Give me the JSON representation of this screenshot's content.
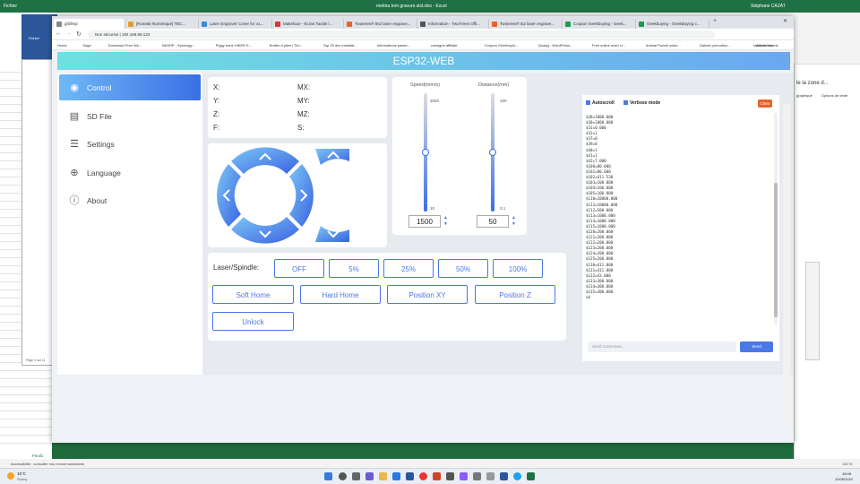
{
  "excel": {
    "title": "mektra tom gravure.xlsl.xlsx - Excel",
    "user": "Stéphane CAZAT",
    "sheet_tab": "Feuil1",
    "status_left": "Accessibilité : consulter nos recommandations",
    "right_panel_title": "le la zone d...",
    "right_panel_sub1": "graphique",
    "right_panel_sub2": "Options de texte",
    "zoom": "100 %"
  },
  "word": {
    "label": "Fichier",
    "page": "Page 1 sur 11"
  },
  "taskbar": {
    "weather_temp": "16°C",
    "weather_desc": "Sunny",
    "time": "18:08",
    "date": "12/06/2022"
  },
  "browser": {
    "tabs": [
      {
        "label": "grblhvp",
        "color": "#888"
      },
      {
        "label": "[Rosette Numérique] TBC...",
        "color": "#e39d2a"
      },
      {
        "label": "Laser Engraver Cover for v1...",
        "color": "#3a8ad6"
      },
      {
        "label": "Makeface - Écran Tactile l...",
        "color": "#d33"
      },
      {
        "label": "Twotrees® tts2 laser engrave...",
        "color": "#e8622c"
      },
      {
        "label": "Information - TwoTrees Offi...",
        "color": "#555"
      },
      {
        "label": "Twotrees® ts2 laser engrave...",
        "color": "#e8622c"
      },
      {
        "label": "Coupon Geekbuying - Geek...",
        "color": "#1c9b4d"
      },
      {
        "label": "Geekbuying - GeekBuying c...",
        "color": "#1c9b4d"
      }
    ],
    "url": "Non sécurisé | 192.168.68.122",
    "bookmarks": [
      "Home",
      "Sage",
      "Download Free We...",
      "NASHP - Synology...",
      "Piggy bank HIKER E...",
      "Boîtier à piles | Tim...",
      "Top 25 des installat...",
      "Informations passe...",
      "consigne affiliate",
      "Coupon Geekbuyin...",
      "Quaag - WordPress...",
      "Free online word cl...",
      "Animal Puzzle swim...",
      "Gabaix promotion...",
      "shellcatches",
      "Autres favoris"
    ]
  },
  "app": {
    "title": "ESP32-WEB",
    "nav": [
      {
        "label": "Control",
        "icon": "gamepad-icon"
      },
      {
        "label": "SD File",
        "icon": "file-icon"
      },
      {
        "label": "Settings",
        "icon": "settings-icon"
      },
      {
        "label": "Language",
        "icon": "globe-icon"
      },
      {
        "label": "About",
        "icon": "info-icon"
      }
    ],
    "coords": {
      "x": "X:",
      "y": "Y:",
      "z": "Z:",
      "f": "F:",
      "mx": "MX:",
      "my": "MY:",
      "mz": "MZ:",
      "s": "S:"
    },
    "speed": {
      "label": "Speed(mm/s)",
      "max": "3000",
      "min": "10",
      "value": "1500",
      "level": 0.5
    },
    "distance": {
      "label": "Distance(mm)",
      "max": "100",
      "min": "0.1",
      "value": "50",
      "level": 0.5
    },
    "laser": {
      "label": "Laser/Spindle:",
      "buttons": [
        "OFF",
        "5%",
        "25%",
        "50%",
        "100%"
      ]
    },
    "actions": [
      "Soft Home",
      "Hard Home",
      "Position XY",
      "Position Z"
    ],
    "unlock": "Unlock",
    "console": {
      "autoscroll": "Autoscroll",
      "verbose": "Verbose mode",
      "clear": "Clear",
      "lines": [
        "$28=1000.000",
        "$30=1000.000",
        "$31=0.000",
        "$32=1",
        "$37=0",
        "$39=0",
        "$40=1",
        "$41=1",
        "$42=7.000",
        "$100=80.000",
        "$101=80.000",
        "$102=411.530",
        "$103=100.000",
        "$104=100.000",
        "$105=100.000",
        "$110=10000.000",
        "$111=10000.000",
        "$112=500.000",
        "$113=1000.000",
        "$114=1000.000",
        "$115=1000.000",
        "$120=200.000",
        "$121=200.000",
        "$122=200.000",
        "$123=200.000",
        "$124=200.000",
        "$125=200.000",
        "$130=411.000",
        "$131=411.000",
        "$132=43.000",
        "$133=300.000",
        "$134=300.000",
        "$135=300.000",
        "ok"
      ],
      "placeholder": "Send Command...",
      "send": "Send"
    }
  },
  "colors": {
    "accent": "#4a78e6",
    "header_start": "#6ee0e0",
    "header_end": "#6aa8f0",
    "clear": "#e8622c"
  }
}
